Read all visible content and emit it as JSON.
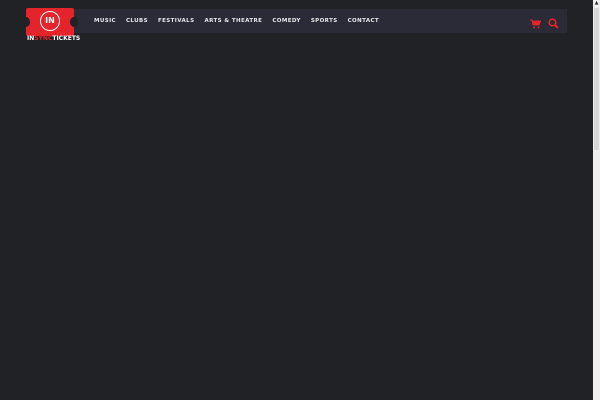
{
  "logo": {
    "prefix": "IN",
    "middle": "SYNC",
    "suffix": "TICKETS",
    "badge": "IN"
  },
  "nav": {
    "items": [
      "MUSIC",
      "CLUBS",
      "FESTIVALS",
      "ARTS & THEATRE",
      "COMEDY",
      "SPORTS",
      "CONTACT"
    ]
  },
  "icons": {
    "cart": "cart-icon",
    "search": "search-icon"
  },
  "colors": {
    "accent": "#e5232b",
    "background": "#212226",
    "navbar": "#2a2b37"
  }
}
